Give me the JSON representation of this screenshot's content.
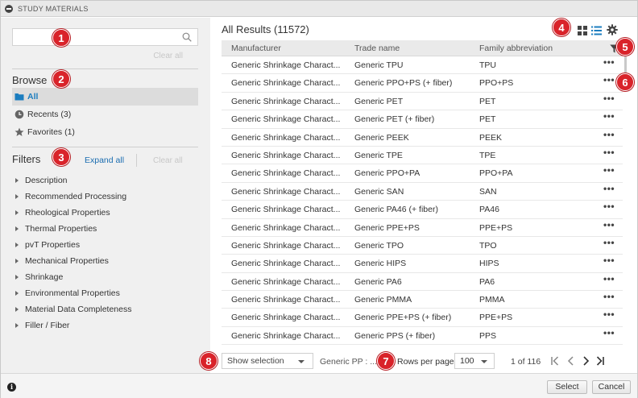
{
  "window": {
    "title": "STUDY MATERIALS"
  },
  "left": {
    "search": {
      "placeholder": "",
      "value": ""
    },
    "clear_all_top": "Clear all",
    "browse": {
      "heading": "Browse",
      "items": [
        {
          "label": "All",
          "icon": "folder-icon",
          "active": true
        },
        {
          "label": "Recents (3)",
          "icon": "clock-icon",
          "active": false
        },
        {
          "label": "Favorites (1)",
          "icon": "star-icon",
          "active": false
        }
      ]
    },
    "filters": {
      "heading": "Filters",
      "expand_all": "Expand all",
      "clear_all": "Clear all",
      "items": [
        "Description",
        "Recommended Processing",
        "Rheological Properties",
        "Thermal Properties",
        "pvT Properties",
        "Mechanical Properties",
        "Shrinkage",
        "Environmental Properties",
        "Material Data Completeness",
        "Filler / Fiber"
      ]
    }
  },
  "results": {
    "heading": "All Results (11572)",
    "columns": [
      "Manufacturer",
      "Trade name",
      "Family abbreviation"
    ],
    "more_glyph": "•••",
    "rows": [
      [
        "Generic Shrinkage Charact...",
        "Generic TPU",
        "TPU"
      ],
      [
        "Generic Shrinkage Charact...",
        "Generic PPO+PS (+ fiber)",
        "PPO+PS"
      ],
      [
        "Generic Shrinkage Charact...",
        "Generic PET",
        "PET"
      ],
      [
        "Generic Shrinkage Charact...",
        "Generic PET (+ fiber)",
        "PET"
      ],
      [
        "Generic Shrinkage Charact...",
        "Generic PEEK",
        "PEEK"
      ],
      [
        "Generic Shrinkage Charact...",
        "Generic TPE",
        "TPE"
      ],
      [
        "Generic Shrinkage Charact...",
        "Generic PPO+PA",
        "PPO+PA"
      ],
      [
        "Generic Shrinkage Charact...",
        "Generic SAN",
        "SAN"
      ],
      [
        "Generic Shrinkage Charact...",
        "Generic PA46 (+ fiber)",
        "PA46"
      ],
      [
        "Generic Shrinkage Charact...",
        "Generic PPE+PS",
        "PPE+PS"
      ],
      [
        "Generic Shrinkage Charact...",
        "Generic TPO",
        "TPO"
      ],
      [
        "Generic Shrinkage Charact...",
        "Generic HIPS",
        "HIPS"
      ],
      [
        "Generic Shrinkage Charact...",
        "Generic PA6",
        "PA6"
      ],
      [
        "Generic Shrinkage Charact...",
        "Generic PMMA",
        "PMMA"
      ],
      [
        "Generic Shrinkage Charact...",
        "Generic PPE+PS (+ fiber)",
        "PPE+PS"
      ],
      [
        "Generic Shrinkage Charact...",
        "Generic PPS (+ fiber)",
        "PPS"
      ]
    ]
  },
  "pager": {
    "show_selection": "Show selection",
    "selected_item": "Generic PP : ...",
    "rows_per_page_label": "Rows per page:",
    "rows_per_page_value": "100",
    "page_of": "1 of 116"
  },
  "footer": {
    "info_glyph": "i",
    "select": "Select",
    "cancel": "Cancel"
  },
  "badges": [
    "1",
    "2",
    "3",
    "4",
    "5",
    "6",
    "7",
    "8"
  ],
  "colors": {
    "accent_blue": "#1b7dbf",
    "badge_red": "#d9232a",
    "panel_grey": "#f0f0f0"
  }
}
